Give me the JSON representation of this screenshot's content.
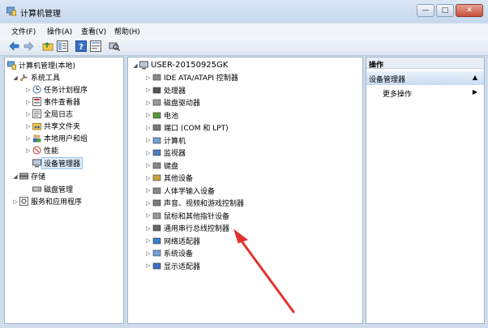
{
  "window": {
    "title": "计算机管理",
    "minimize": "—",
    "maximize": "□",
    "close": "✕"
  },
  "menu": [
    "文件(F)",
    "操作(A)",
    "查看(V)",
    "帮助(H)"
  ],
  "left_tree": {
    "root": "计算机管理(本地)",
    "system_tools": "系统工具",
    "system_children": [
      "任务计划程序",
      "事件查看器",
      "全局日志",
      "共享文件夹",
      "本地用户和组",
      "性能",
      "设备管理器"
    ],
    "storage": "存储",
    "disk_mgmt": "磁盘管理",
    "services": "服务和应用程序"
  },
  "devices": {
    "computer_name": "USER-20150925GK",
    "items": [
      "IDE ATA/ATAPI 控制器",
      "处理器",
      "磁盘驱动器",
      "电池",
      "端口 (COM 和 LPT)",
      "计算机",
      "监视器",
      "键盘",
      "其他设备",
      "人体学输入设备",
      "声音、视频和游戏控制器",
      "鼠标和其他指针设备",
      "通用串行总线控制器",
      "网络适配器",
      "系统设备",
      "显示适配器"
    ]
  },
  "actions": {
    "header": "操作",
    "section": "设备管理器",
    "more": "更多操作"
  },
  "colors": {
    "arrow": "#e0332f",
    "selection": "#dcebfb"
  }
}
